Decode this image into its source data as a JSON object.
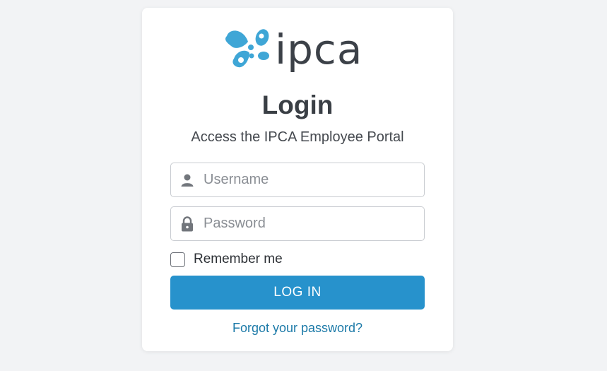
{
  "brand": {
    "logo_text": "ipca",
    "logo_icon": "butterfly-logo",
    "colors": {
      "logo_blue": "#3fa6d6",
      "text_dark": "#3c4148"
    }
  },
  "title": "Login",
  "subtitle": "Access the IPCA Employee Portal",
  "form": {
    "username": {
      "placeholder": "Username",
      "value": "",
      "icon": "user-icon"
    },
    "password": {
      "placeholder": "Password",
      "value": "",
      "icon": "lock-icon"
    },
    "remember_label": "Remember me",
    "remember_checked": false,
    "login_label": "LOG IN",
    "forgot_label": "Forgot your password?"
  },
  "colors": {
    "accent": "#2792cc",
    "link": "#1c7aa8",
    "background": "#f2f3f5",
    "card": "#ffffff"
  }
}
